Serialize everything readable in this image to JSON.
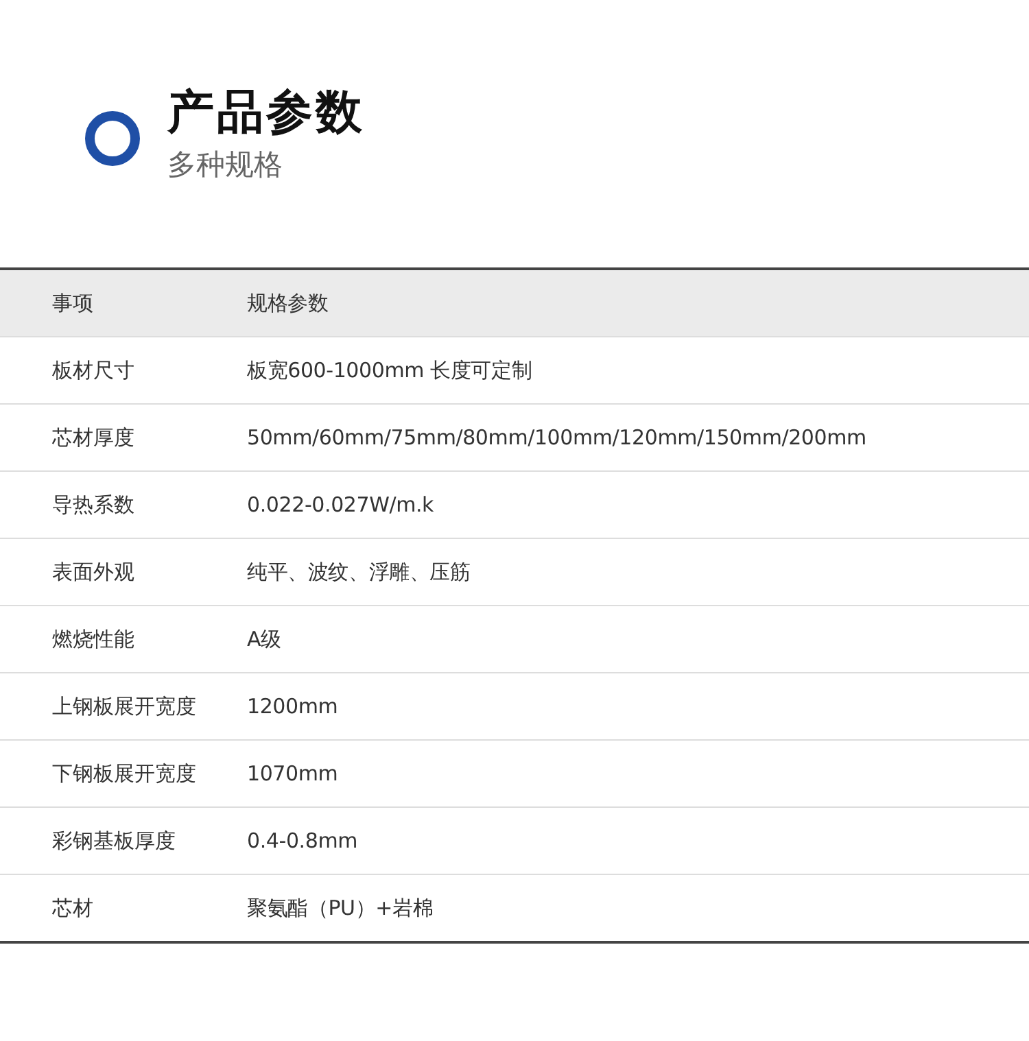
{
  "header": {
    "title": "产品参数",
    "subtitle": "多种规格"
  },
  "table": {
    "columns": [
      "事项",
      "规格参数"
    ],
    "rows": [
      [
        "板材尺寸",
        "板宽600-1000mm  长度可定制"
      ],
      [
        "芯材厚度",
        "50mm/60mm/75mm/80mm/100mm/120mm/150mm/200mm"
      ],
      [
        "导热系数",
        "0.022-0.027W/m.k"
      ],
      [
        "表面外观",
        "纯平、波纹、浮雕、压筋"
      ],
      [
        "燃烧性能",
        "A级"
      ],
      [
        "上钢板展开宽度",
        "1200mm"
      ],
      [
        "下钢板展开宽度",
        "1070mm"
      ],
      [
        "彩钢基板厚度",
        "0.4-0.8mm"
      ],
      [
        "芯材",
        "聚氨酯（PU）+岩棉"
      ]
    ]
  }
}
